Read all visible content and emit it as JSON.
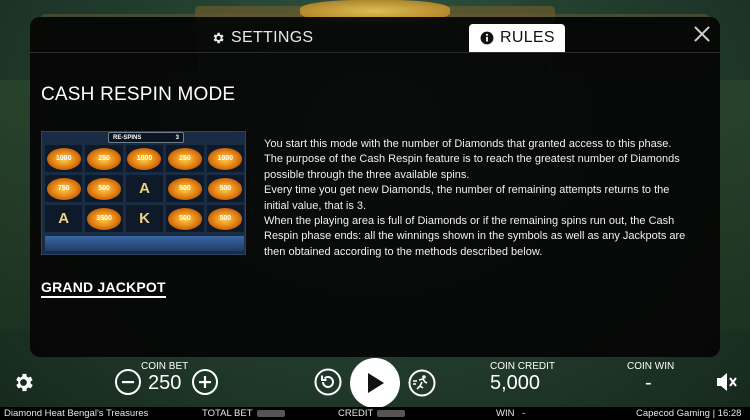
{
  "modal": {
    "tabs": [
      {
        "label": "SETTINGS",
        "active": false,
        "icon": "gear-icon"
      },
      {
        "label": "RULES",
        "active": true,
        "icon": "info-icon"
      }
    ],
    "section_title": "CASH RESPIN MODE",
    "mini_reel": {
      "header_label": "RE-SPINS",
      "header_count": "3",
      "cells": [
        "1000",
        "250",
        "1000",
        "250",
        "1000",
        "750",
        "500",
        "A",
        "500",
        "500",
        "A",
        "3500",
        "K",
        "500",
        "500"
      ]
    },
    "paragraphs": [
      "You start this mode with the number of Diamonds that granted access to this phase.",
      "The purpose of the Cash Respin feature is to reach the greatest number of Diamonds possible through the three available spins.",
      "Every time you get new Diamonds, the number of remaining attempts returns to the initial value, that is 3.",
      "When the playing area is full of Diamonds or if the remaining spins run out, the Cash Respin phase ends: all the winnings shown in the symbols as well as any Jackpots are then obtained according to the methods described below."
    ],
    "sub_title": "GRAND JACKPOT"
  },
  "bottom_bar": {
    "coin_bet_label": "COIN BET",
    "coin_bet_value": "250",
    "coin_credit_label": "COIN CREDIT",
    "coin_credit_value": "5,000",
    "coin_win_label": "COIN WIN",
    "coin_win_value": "-"
  },
  "status_bar": {
    "game_name": "Diamond Heat Bengal's Treasures",
    "total_bet_label": "TOTAL BET",
    "credit_label": "CREDIT",
    "win_label": "WIN",
    "win_value": "-",
    "provider": "Capecod Gaming | 16:28"
  },
  "colors": {
    "modal_bg": "#050505",
    "active_tab_bg": "#ffffff",
    "diamond": "#ffd24a"
  }
}
